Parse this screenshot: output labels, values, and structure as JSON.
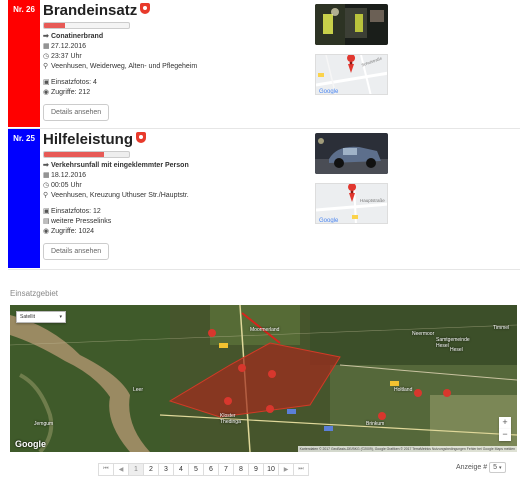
{
  "entries": [
    {
      "number": "Nr. 26",
      "badge_color": "#ff0000",
      "title": "Brandeinsatz",
      "progress": 0.25,
      "type": "Conatinerbrand",
      "date": "27.12.2016",
      "time": "23:37 Uhr",
      "location": "Veenhusen, Weiderweg, Alten- und Pflegeheim",
      "photos": "Einsatzfotos: 4",
      "press": "",
      "hits": "Zugriffe: 212",
      "details_label": "Details ansehen",
      "map_street": "Schulstraße"
    },
    {
      "number": "Nr. 25",
      "badge_color": "#0000ff",
      "title": "Hilfeleistung",
      "progress": 0.7,
      "type": "Verkehrsunfall mit eingeklemmter Person",
      "date": "18.12.2016",
      "time": "00:05 Uhr",
      "location": "Veenhusen, Kreuzung Uthuser Str./Hauptstr.",
      "photos": "Einsatzfotos: 12",
      "press": "weitere Presselinks",
      "hits": "Zugriffe: 1024",
      "details_label": "Details ansehen",
      "map_street": "Hauptstraße"
    }
  ],
  "section_title": "Einsatzgebiet",
  "map": {
    "type_select": "Satellit",
    "zoom_in": "+",
    "zoom_out": "−",
    "google": "Google",
    "attribution": "Kartendaten © 2017 GeoBasis-DE/BKG (©2009), Google Grafiken © 2017 TerraMetrics   Nutzungsbedingungen   Fehler bei Google Maps melden",
    "labels": {
      "moormerland": "Moormerland",
      "leer": "Leer",
      "neermoor": "Neermoor",
      "jemgum": "Jemgum",
      "kloster": "Kloster Thedinga",
      "hesel": "Hesel",
      "holtland": "Holtland",
      "brinkum": "Brinkum",
      "timmel": "Timmel",
      "samtgemeinde": "Samtgemeinde Hesel"
    }
  },
  "pagination": {
    "first": "⏮",
    "prev": "◀",
    "pages": [
      "1",
      "2",
      "3",
      "4",
      "5",
      "6",
      "7",
      "8",
      "9",
      "10"
    ],
    "active": "1",
    "next": "▶",
    "last": "⏭"
  },
  "per_page": {
    "label": "Anzeige #",
    "value": "5"
  }
}
